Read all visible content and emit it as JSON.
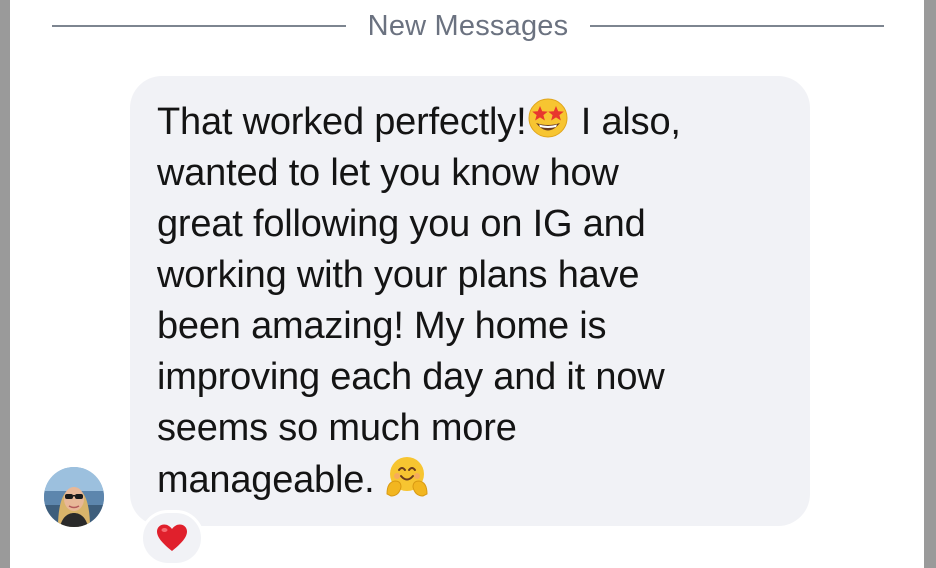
{
  "divider": {
    "label": "New Messages"
  },
  "message": {
    "part1": "That worked perfectly!",
    "emoji1": "star-struck-emoji",
    "part2": " I also,\nwanted to let you know how\ngreat following you on IG and\nworking with your plans have\nbeen amazing! My home is\nimproving each day and it now\nseems so much more\nmanageable. ",
    "emoji2": "hugging-face-emoji"
  },
  "reaction": {
    "icon": "heart-icon",
    "color": "#e0202c"
  },
  "colors": {
    "bubble": "#f1f2f6",
    "divider_line": "#7d8590",
    "divider_text": "#6b7280",
    "text": "#141414"
  }
}
